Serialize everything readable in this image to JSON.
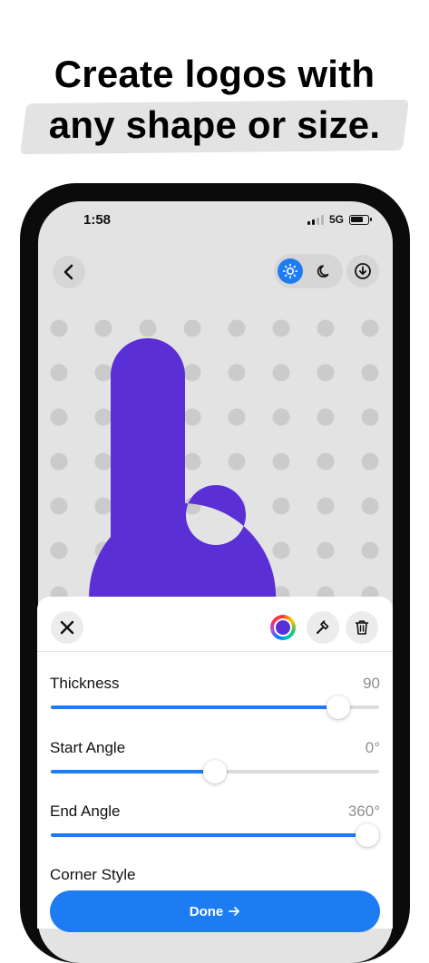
{
  "promo": {
    "line1": "Create logos with",
    "line2": "any shape or size."
  },
  "status": {
    "time": "1:58",
    "network": "5G"
  },
  "toolbar": {
    "back_icon": "chevron-left-icon",
    "light_icon": "sun-icon",
    "dark_icon": "moon-icon",
    "download_icon": "download-icon",
    "active_theme": "light",
    "accent": "#1e7cf2"
  },
  "logo": {
    "color": "#5b2fd6"
  },
  "sheet": {
    "close_icon": "close-icon",
    "color_icon": "color-wheel-icon",
    "hammer_icon": "hammer-icon",
    "trash_icon": "trash-icon",
    "controls": [
      {
        "label": "Thickness",
        "value": "90",
        "fraction": 0.875
      },
      {
        "label": "Start Angle",
        "value": "0°",
        "fraction": 0.5
      },
      {
        "label": "End Angle",
        "value": "360°",
        "fraction": 1.0
      }
    ],
    "corner_style_label": "Corner Style",
    "done_label": "Done",
    "done_icon": "arrow-right-icon"
  }
}
